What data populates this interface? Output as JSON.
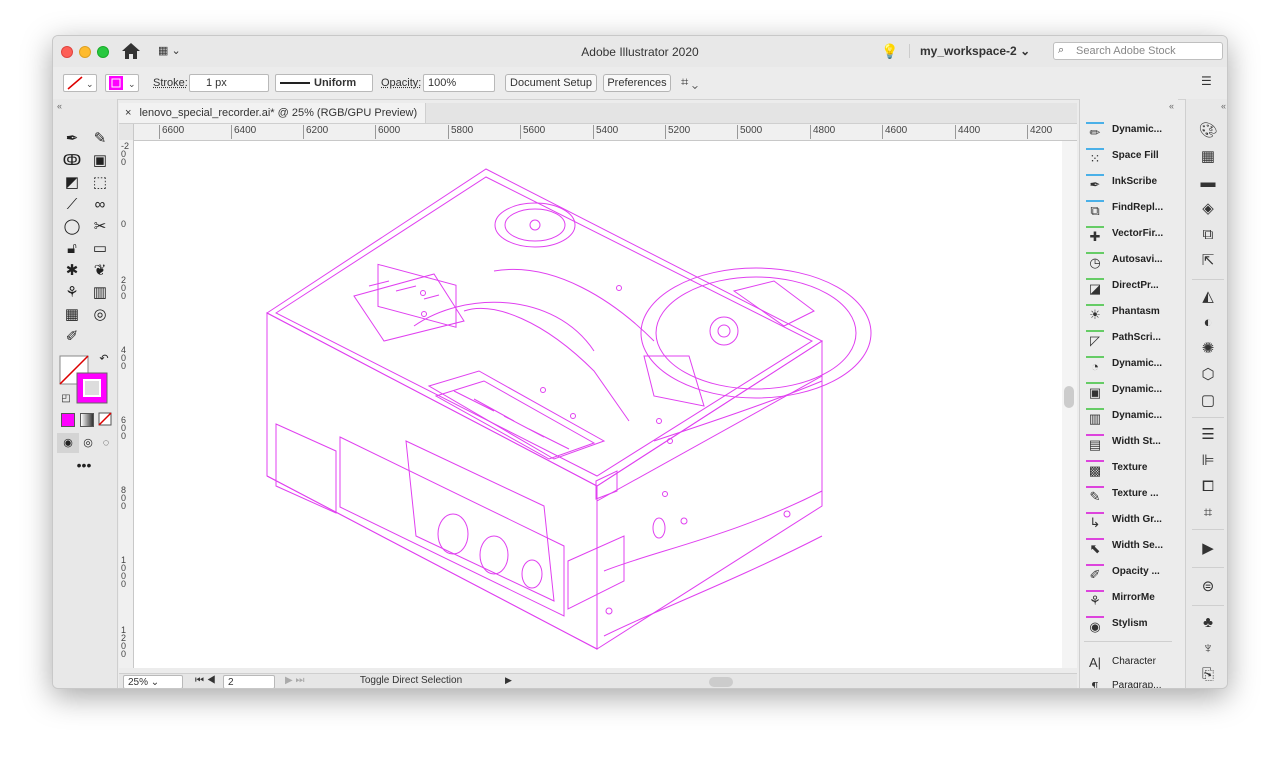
{
  "app": {
    "title": "Adobe Illustrator 2020",
    "workspace": "my_workspace-2",
    "search_placeholder": "Search Adobe Stock"
  },
  "control_bar": {
    "stroke_label": "Stroke:",
    "stroke_weight": "1 px",
    "brush_profile": "Uniform",
    "opacity_label": "Opacity:",
    "opacity_value": "100%",
    "document_setup": "Document Setup",
    "preferences": "Preferences"
  },
  "document_tab": {
    "title": "lenovo_special_recorder.ai* @ 25% (RGB/GPU Preview)",
    "close": "×"
  },
  "ruler": {
    "horizontal": [
      "6600",
      "6400",
      "6200",
      "6000",
      "5800",
      "5600",
      "5400",
      "5200",
      "5000",
      "4800",
      "4600",
      "4400",
      "4200"
    ],
    "vertical": [
      "-200",
      "0",
      "200",
      "400",
      "600",
      "800",
      "1000",
      "1200"
    ]
  },
  "status": {
    "zoom": "25%",
    "artboard": "2",
    "tool_hint": "Toggle Direct Selection"
  },
  "colors": {
    "stroke_accent": "#ff00ff",
    "fill_swatch": "#ff00ff",
    "artwork": "#e040f0"
  },
  "tools": [
    "pen-icon",
    "curvature-icon",
    "lasso-icon",
    "image-trace-icon",
    "shape-builder-icon",
    "free-transform-icon",
    "smooth-icon",
    "blend-icon",
    "ellipse-icon",
    "scissors-icon",
    "lock-icon",
    "artboard-icon",
    "puppet-warp-icon",
    "warp-icon",
    "butterfly-icon",
    "ruler-icon",
    "grid-icon",
    "spiral-icon",
    "eyedropper-icon"
  ],
  "plugins": [
    {
      "label": "Dynamic...",
      "icon": "dynamic-sketch-icon"
    },
    {
      "label": "Space Fill",
      "icon": "space-fill-icon"
    },
    {
      "label": "InkScribe",
      "icon": "inkscribe-icon"
    },
    {
      "label": "FindRepl...",
      "icon": "find-replace-icon"
    },
    {
      "label": "VectorFir...",
      "icon": "vector-first-aid-icon"
    },
    {
      "label": "Autosavi...",
      "icon": "autosave-icon"
    },
    {
      "label": "DirectPr...",
      "icon": "direct-prefs-icon"
    },
    {
      "label": "Phantasm",
      "icon": "phantasm-icon"
    },
    {
      "label": "PathScri...",
      "icon": "path-scribe-icon"
    },
    {
      "label": "Dynamic...",
      "icon": "dynamic-shapes-icon"
    },
    {
      "label": "Dynamic...",
      "icon": "dynamic-corners-icon"
    },
    {
      "label": "Dynamic...",
      "icon": "dynamic-measure-icon"
    },
    {
      "label": "Width St...",
      "icon": "width-stripes-icon"
    },
    {
      "label": "Texture",
      "icon": "texture-icon"
    },
    {
      "label": "Texture ...",
      "icon": "texture-brushes-icon"
    },
    {
      "label": "Width Gr...",
      "icon": "width-gradient-icon"
    },
    {
      "label": "Width Se...",
      "icon": "width-selector-icon"
    },
    {
      "label": "Opacity ...",
      "icon": "opacity-brush-icon"
    },
    {
      "label": "MirrorMe",
      "icon": "mirrorme-icon"
    },
    {
      "label": "Stylism",
      "icon": "stylism-icon"
    },
    {
      "label": "Character",
      "icon": "character-icon"
    },
    {
      "label": "Paragrap...",
      "icon": "paragraph-icon"
    }
  ]
}
